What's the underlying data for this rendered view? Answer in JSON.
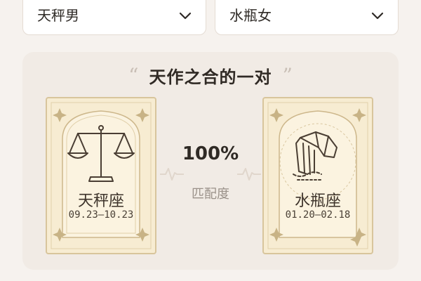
{
  "selectors": {
    "left": {
      "value": "天秤男"
    },
    "right": {
      "value": "水瓶女"
    }
  },
  "match": {
    "open_quote": "“",
    "title": "天作之合的一对",
    "close_quote": "”",
    "percent": "100%",
    "label": "匹配度"
  },
  "cards": {
    "left": {
      "name": "天秤座",
      "dates": "09.23–10.23",
      "symbol": "scales-icon"
    },
    "right": {
      "name": "水瓶座",
      "dates": "01.20–02.18",
      "symbol": "water-bearer-icon"
    }
  },
  "colors": {
    "card_bg": "#f7ecd2",
    "card_border": "#d8c59c",
    "accent_text": "#302a25",
    "muted_text": "#9a9189"
  }
}
